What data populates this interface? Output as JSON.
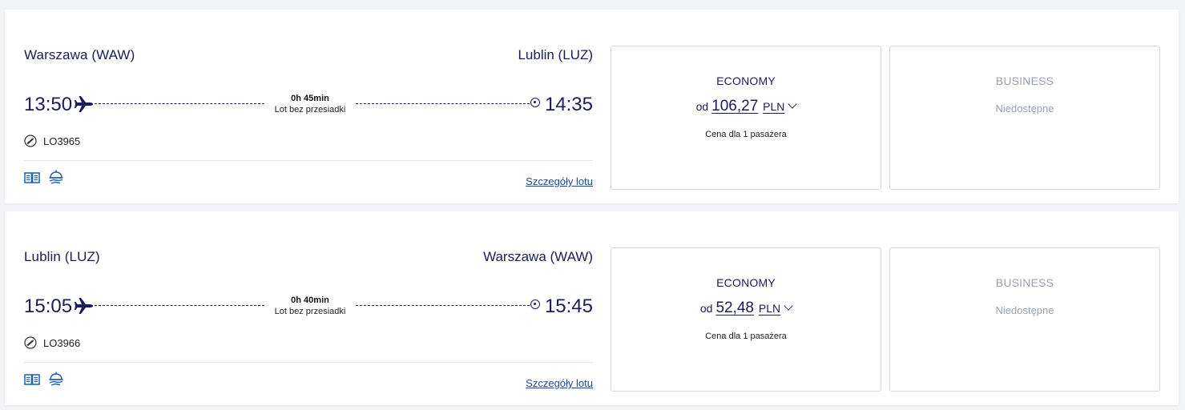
{
  "flights": [
    {
      "origin": "Warszawa (WAW)",
      "destination": "Lublin (LUZ)",
      "departure_time": "13:50",
      "arrival_time": "14:35",
      "duration": "0h 45min",
      "stops": "Lot bez przesiadki",
      "flight_number": "LO3965",
      "details_link": "Szczegóły lotu",
      "economy": {
        "class_label": "ECONOMY",
        "price_prefix": "od",
        "price_amount": "106,27",
        "currency": "PLN",
        "per_passenger": "Cena dla 1 pasażera"
      },
      "business": {
        "class_label": "BUSINESS",
        "status": "Niedostępne"
      }
    },
    {
      "origin": "Lublin (LUZ)",
      "destination": "Warszawa (WAW)",
      "departure_time": "15:05",
      "arrival_time": "15:45",
      "duration": "0h 40min",
      "stops": "Lot bez przesiadki",
      "flight_number": "LO3966",
      "details_link": "Szczegóły lotu",
      "economy": {
        "class_label": "ECONOMY",
        "price_prefix": "od",
        "price_amount": "52,48",
        "currency": "PLN",
        "per_passenger": "Cena dla 1 pasażera"
      },
      "business": {
        "class_label": "BUSINESS",
        "status": "Niedostępne"
      }
    }
  ],
  "icons": {
    "plane": "plane-icon",
    "destination_marker": "destination-marker-icon",
    "airline_logo": "lot-airline-logo-icon",
    "entertainment": "book-icon",
    "meal": "meal-service-icon",
    "expand": "chevron-down-icon"
  },
  "colors": {
    "primary_text": "#1c1c5a",
    "link": "#1a4b9e",
    "disabled_text": "#9aa0b4",
    "icon_blue": "#1a5fb4"
  }
}
